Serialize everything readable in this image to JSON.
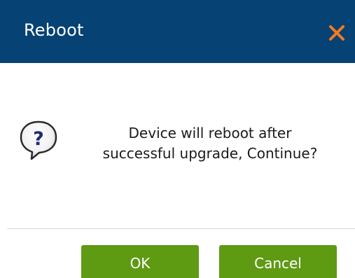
{
  "dialog": {
    "title": "Reboot",
    "close_icon": "close-icon",
    "message_line1": "Device will reboot after",
    "message_line2": "successful upgrade, Continue?",
    "question_icon": "question-icon",
    "ok_label": "OK",
    "cancel_label": "Cancel"
  },
  "colors": {
    "titlebar": "#064273",
    "close_icon": "#f47a20",
    "button": "#5e9a12",
    "question_mark": "#1f2a7a"
  }
}
